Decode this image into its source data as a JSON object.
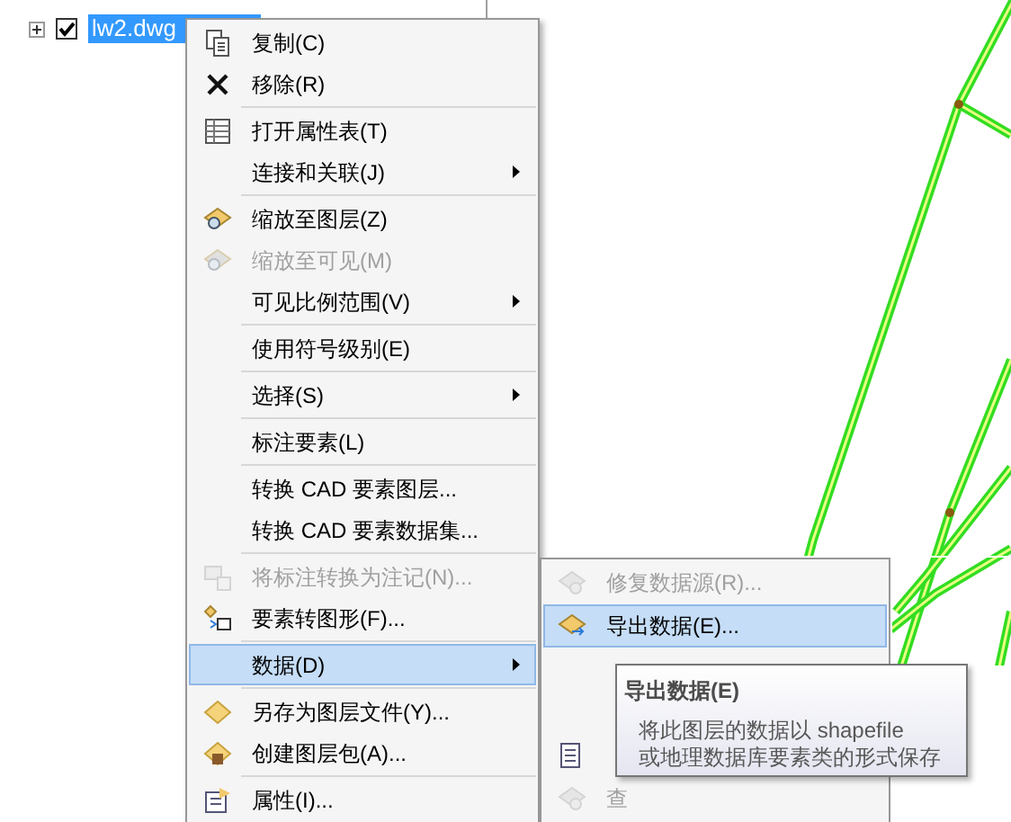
{
  "tree": {
    "items": [
      {
        "label": "lw2.dwg",
        "checked": true,
        "selected": true,
        "expanded": false
      }
    ]
  },
  "context_menu": {
    "items": [
      {
        "kind": "item",
        "label": "复制(C)",
        "disabled": false,
        "selected": false,
        "submenu": false
      },
      {
        "kind": "item",
        "label": "移除(R)",
        "disabled": false,
        "selected": false,
        "submenu": false
      },
      {
        "kind": "separator"
      },
      {
        "kind": "item",
        "label": "打开属性表(T)",
        "disabled": false,
        "selected": false,
        "submenu": false
      },
      {
        "kind": "item",
        "label": "连接和关联(J)",
        "disabled": false,
        "selected": false,
        "submenu": true
      },
      {
        "kind": "separator"
      },
      {
        "kind": "item",
        "label": "缩放至图层(Z)",
        "disabled": false,
        "selected": false,
        "submenu": false
      },
      {
        "kind": "item",
        "label": "缩放至可见(M)",
        "disabled": true,
        "selected": false,
        "submenu": false
      },
      {
        "kind": "item",
        "label": "可见比例范围(V)",
        "disabled": false,
        "selected": false,
        "submenu": true
      },
      {
        "kind": "separator"
      },
      {
        "kind": "item",
        "label": "使用符号级别(E)",
        "disabled": false,
        "selected": false,
        "submenu": false
      },
      {
        "kind": "separator"
      },
      {
        "kind": "item",
        "label": "选择(S)",
        "disabled": false,
        "selected": false,
        "submenu": true
      },
      {
        "kind": "separator"
      },
      {
        "kind": "item",
        "label": "标注要素(L)",
        "disabled": false,
        "selected": false,
        "submenu": false
      },
      {
        "kind": "separator"
      },
      {
        "kind": "item",
        "label": "转换 CAD 要素图层...",
        "disabled": false,
        "selected": false,
        "submenu": false
      },
      {
        "kind": "item",
        "label": "转换 CAD 要素数据集...",
        "disabled": false,
        "selected": false,
        "submenu": false
      },
      {
        "kind": "separator"
      },
      {
        "kind": "item",
        "label": "将标注转换为注记(N)...",
        "disabled": true,
        "selected": false,
        "submenu": false
      },
      {
        "kind": "item",
        "label": "要素转图形(F)...",
        "disabled": false,
        "selected": false,
        "submenu": false
      },
      {
        "kind": "separator"
      },
      {
        "kind": "item",
        "label": "数据(D)",
        "disabled": false,
        "selected": true,
        "submenu": true
      },
      {
        "kind": "separator"
      },
      {
        "kind": "item",
        "label": "另存为图层文件(Y)...",
        "disabled": false,
        "selected": false,
        "submenu": false
      },
      {
        "kind": "item",
        "label": "创建图层包(A)...",
        "disabled": false,
        "selected": false,
        "submenu": false
      },
      {
        "kind": "separator"
      },
      {
        "kind": "item",
        "label": "属性(I)...",
        "disabled": false,
        "selected": false,
        "submenu": false
      }
    ]
  },
  "data_submenu": {
    "items": [
      {
        "kind": "item",
        "label": "修复数据源(R)...",
        "disabled": true,
        "selected": false
      },
      {
        "kind": "item",
        "label": "导出数据(E)...",
        "disabled": false,
        "selected": true
      },
      {
        "kind": "covered"
      },
      {
        "kind": "covered"
      },
      {
        "kind": "covered"
      },
      {
        "kind": "item",
        "label": "查",
        "disabled": true,
        "selected": false
      }
    ]
  },
  "tooltip": {
    "title": "导出数据(E)",
    "lines": [
      "将此图层的数据以 shapefile",
      "或地理数据库要素类的形式保存"
    ]
  }
}
